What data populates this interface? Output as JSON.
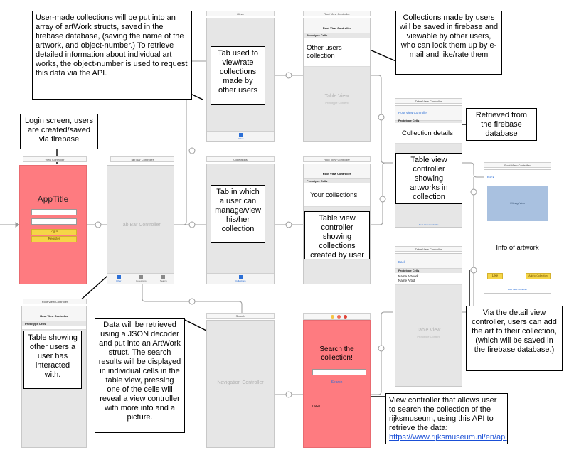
{
  "scenes": {
    "login": {
      "title": "View Controller",
      "app_title": "AppTitle",
      "login_btn": "Log In",
      "register_btn": "Register"
    },
    "tabbar": {
      "title": "Tab Bar Controller",
      "center_label": "Tab Bar Controller",
      "tabs": [
        "Other",
        "Collections",
        "Search"
      ]
    },
    "other": {
      "title": "Other",
      "tab": "Other"
    },
    "collections": {
      "title": "Collections",
      "tab": "Collections"
    },
    "search": {
      "title": "Search",
      "center_label": "Navigation Controller"
    },
    "root_top": {
      "title": "Root View Controller",
      "nav_title": "Root View Controller",
      "proto": "Prototype Cells",
      "tv_label": "Table View",
      "tv_sub": "Prototype Content"
    },
    "root_mid": {
      "title": "Root View Controller",
      "nav_title": "Root View Controller",
      "proto": "Prototype Cells"
    },
    "root_small": {
      "title": "Root View Controller",
      "nav_title": "Root View Controller",
      "proto": "Prototype Cells"
    },
    "detail_top": {
      "title": "Table View Controller",
      "back": "Root View Controller",
      "proto": "Prototype Cells",
      "link": "Root View Controller"
    },
    "detail_bottom": {
      "title": "Table View Controller",
      "back": "Back",
      "proto": "Prototype Cells",
      "name_artwork": "Name Artwork",
      "name_artist": "Name Artist",
      "tv_label": "Table View",
      "tv_sub": "Prototype Content"
    },
    "info": {
      "title": "Root View Controller",
      "back": "Back",
      "image_label": "UIImageView",
      "like_btn": "Like",
      "add_btn": "Add to Collection",
      "link": "Root View Controller"
    },
    "searchvc": {
      "search_placeholder": "",
      "search_btn": "Search",
      "label": "Label",
      "dot_colors": [
        "#f5c542",
        "#ef6b57",
        "#e0453a"
      ]
    }
  },
  "in_scene_text": {
    "other_users": "Other users collection",
    "your_collections": "Your collections",
    "collection_details": "Collection details",
    "info_of_artwork": "Info of artwork",
    "search_heading": "Search the collection!"
  },
  "notes": {
    "user_made": "User-made collections will be put into an array of artWork structs, saved in the firebase database, (saving the name of the artwork, and object-number.) To retrieve detailed information about individual art works, the object-number is used to request this data via the API.",
    "collections_firebase": "Collections made by users will be saved in firebase and viewable by other users, who can look them up by e-mail and like/rate them",
    "login_screen": "Login screen, users are created/saved via firebase",
    "tab_other": "Tab used to view/rate collections made by other users",
    "tab_manage": "Tab in which a user can manage/view his/her collection",
    "tv_created": "Table view controller showing collections created by user",
    "tv_artworks": "Table view controller showing artworks in collection",
    "retrieved": "Retrieved from the firebase database",
    "table_other": "Table showing other users a user has interacted with.",
    "json": "Data will be retrieved using a JSON decoder and put into an ArtWork struct. The search results will be displayed in individual cells in the table view, pressing one of the cells will reveal a view controller with more info and a picture.",
    "detail_add": "Via the detail view controller, users can add the art to their collection, (which will be saved in the firebase database.)",
    "search_vc": "View controller that allows user to search the collection of the rijksmuseum, using this API to retrieve the data:",
    "api_link": "https://www.rijksmuseum.nl/en/api"
  },
  "colors": {
    "login_bg": "#fe7b80",
    "search_bg": "#fe7b80",
    "accent": "#2c6fd6",
    "button_yellow": "#f5d547"
  }
}
